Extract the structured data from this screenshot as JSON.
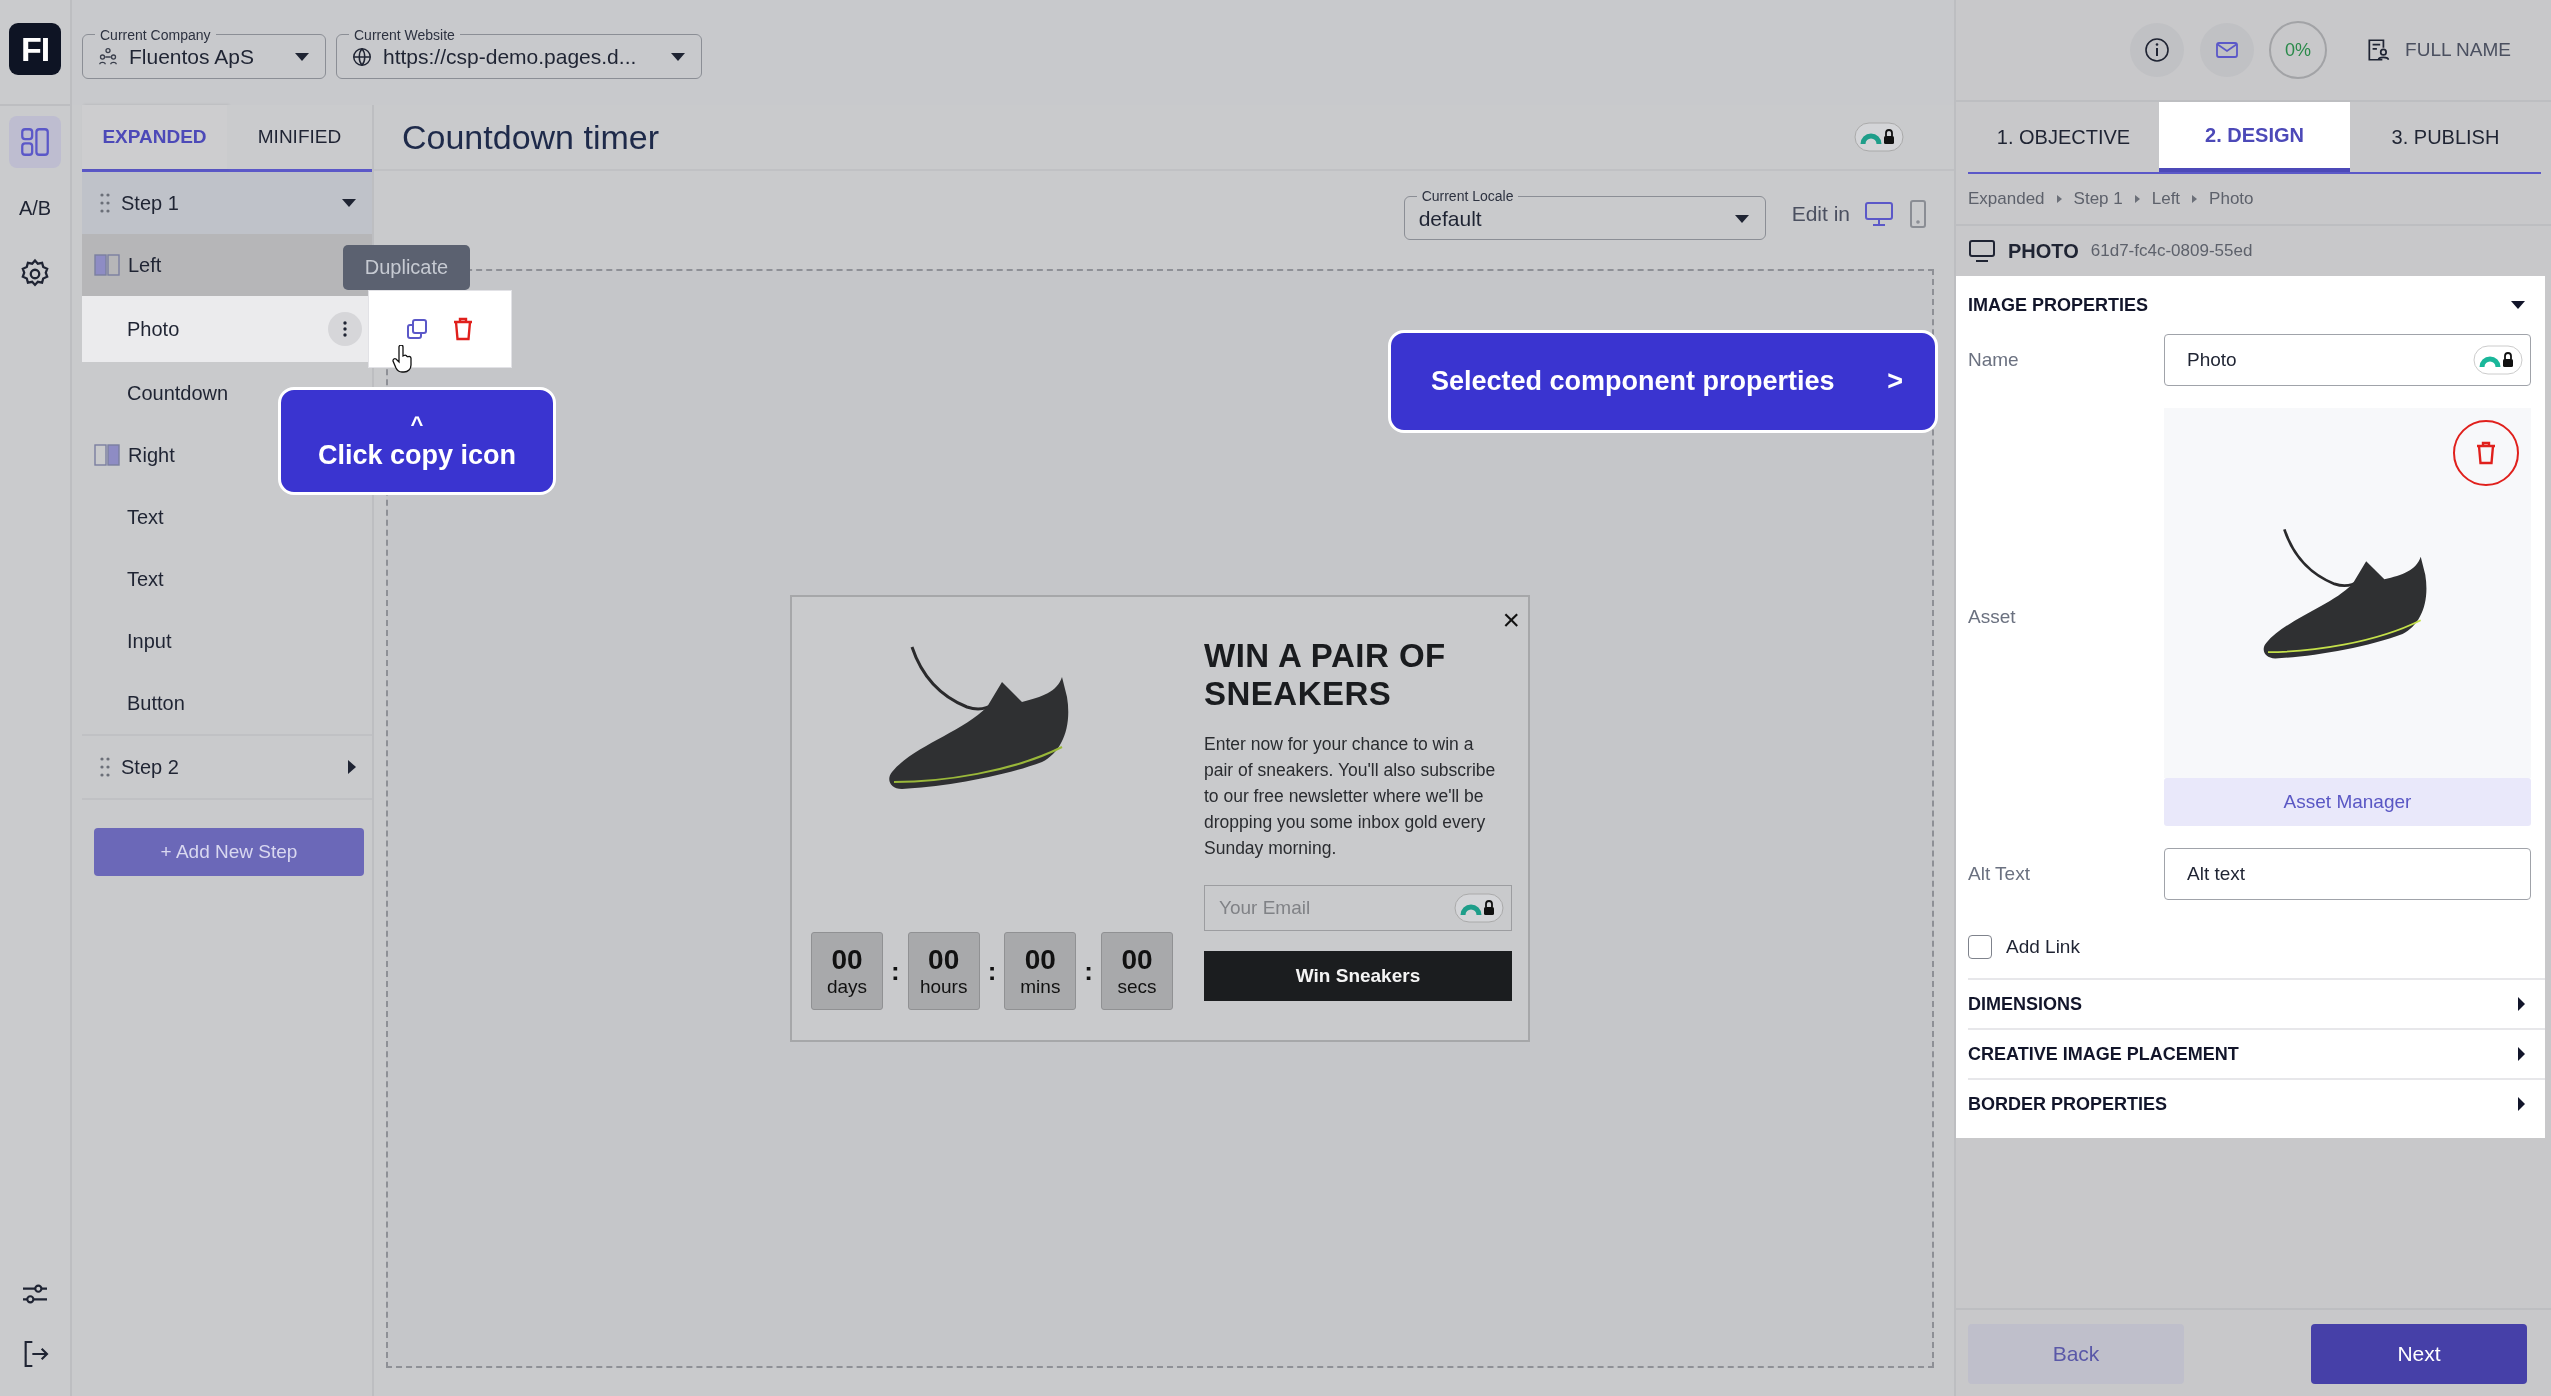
{
  "rail": {
    "logo": "FI",
    "items": [
      {
        "kind": "layout",
        "selected": true
      },
      {
        "kind": "ab",
        "label": "A/B",
        "selected": false
      },
      {
        "kind": "settings",
        "selected": false
      }
    ],
    "bottom_items": [
      {
        "kind": "sliders"
      },
      {
        "kind": "logout"
      }
    ]
  },
  "top_bar": {
    "company": {
      "label": "Current Company",
      "value": "Fluentos ApS"
    },
    "website": {
      "label": "Current Website",
      "value": "https://csp-demo.pages.d..."
    }
  },
  "view_tabs": [
    {
      "label": "EXPANDED",
      "selected": true
    },
    {
      "label": "MINIFIED",
      "selected": false
    }
  ],
  "tree": [
    {
      "kind": "step",
      "label": "Step 1",
      "expanded": true,
      "children": [
        {
          "kind": "column",
          "label": "Left",
          "first_half_filled": true,
          "highlighted": true,
          "children": [
            {
              "kind": "element",
              "label": "Photo",
              "selected": true
            },
            {
              "kind": "element",
              "label": "Countdown",
              "selected": false
            }
          ]
        },
        {
          "kind": "column",
          "label": "Right",
          "first_half_filled": false,
          "highlighted": false,
          "children": [
            {
              "kind": "element",
              "label": "Text",
              "selected": false
            },
            {
              "kind": "element",
              "label": "Text",
              "selected": false
            },
            {
              "kind": "element",
              "label": "Input",
              "selected": false
            },
            {
              "kind": "element",
              "label": "Button",
              "selected": false
            }
          ]
        }
      ]
    },
    {
      "kind": "step",
      "label": "Step 2",
      "expanded": false
    }
  ],
  "add_step_button": "+ Add New Step",
  "row_actions": {
    "tooltip": "Duplicate"
  },
  "callouts": [
    {
      "kind": "vertical",
      "pointer": "^",
      "text": "Click copy icon"
    },
    {
      "kind": "horizontal",
      "pointer": ">",
      "text": "Selected component properties"
    }
  ],
  "editor": {
    "title": "Countdown timer",
    "locale": {
      "label": "Current Locale",
      "value": "default"
    },
    "edit_in": "Edit in",
    "devices": [
      {
        "kind": "desktop",
        "selected": true
      },
      {
        "kind": "mobile",
        "selected": false
      }
    ]
  },
  "popup": {
    "close": "×",
    "heading": "WIN A PAIR OF SNEAKERS",
    "body": "Enter now for your chance to win a pair of sneakers. You'll also subscribe to our free newsletter where we'll be dropping you some inbox gold every Sunday morning.",
    "countdown": [
      {
        "value": "00",
        "unit": "days"
      },
      {
        "value": "00",
        "unit": "hours"
      },
      {
        "value": "00",
        "unit": "mins"
      },
      {
        "value": "00",
        "unit": "secs"
      }
    ],
    "separator": ":",
    "email_placeholder": "Your Email",
    "button": "Win Sneakers"
  },
  "right_panel": {
    "progress": "0%",
    "user": "FULL NAME",
    "steps": [
      {
        "label": "1. OBJECTIVE",
        "selected": false
      },
      {
        "label": "2. DESIGN",
        "selected": true
      },
      {
        "label": "3. PUBLISH",
        "selected": false
      }
    ],
    "breadcrumb": [
      "Expanded",
      "Step 1",
      "Left",
      "Photo"
    ],
    "component": {
      "type": "PHOTO",
      "id": "61d7-fc4c-0809-55ed"
    },
    "image_properties": {
      "title": "IMAGE PROPERTIES",
      "expanded": true,
      "name_label": "Name",
      "name_value": "Photo",
      "asset_label": "Asset",
      "asset_manager": "Asset Manager",
      "alt_label": "Alt Text",
      "alt_value": "Alt text",
      "add_link": {
        "label": "Add Link",
        "checked": false
      }
    },
    "sections": [
      {
        "title": "DIMENSIONS",
        "expanded": false
      },
      {
        "title": "CREATIVE IMAGE PLACEMENT",
        "expanded": false
      },
      {
        "title": "BORDER PROPERTIES",
        "expanded": false
      }
    ],
    "back": "Back",
    "next": "Next"
  }
}
